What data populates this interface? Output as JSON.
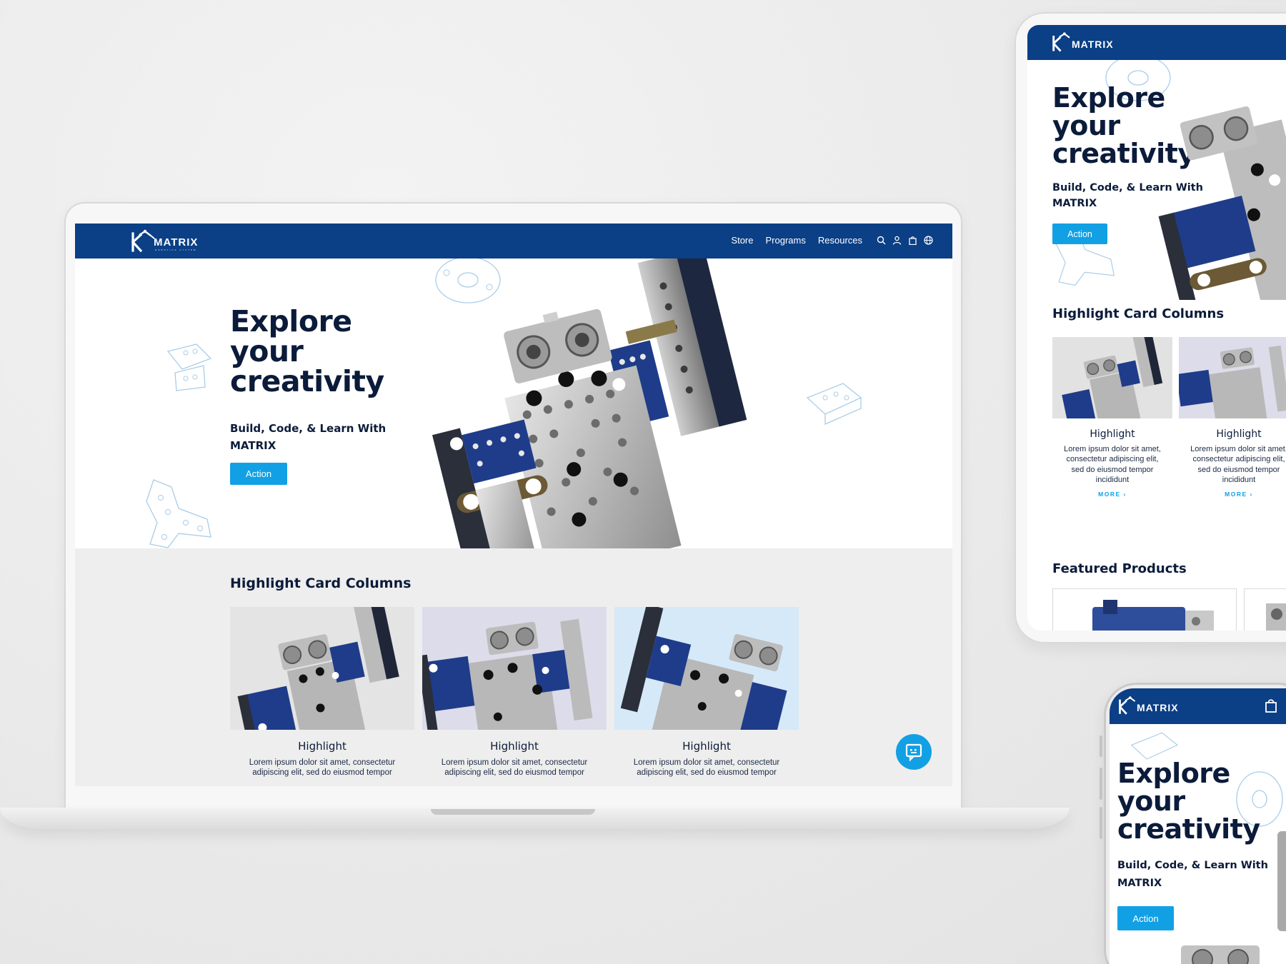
{
  "brand": {
    "name": "MATRIX",
    "tagline": "ROBOTICS SYSTEM"
  },
  "nav": {
    "links": [
      "Store",
      "Programs",
      "Resources"
    ]
  },
  "hero": {
    "title_lines": [
      "Explore",
      "your",
      "creativity"
    ],
    "subtitle_line1": "Build, Code, & Learn With",
    "subtitle_line2": "MATRIX",
    "action_label": "Action"
  },
  "highlights": {
    "title": "Highlight Card Columns",
    "cards": [
      {
        "title": "Highlight",
        "text": "Lorem ipsum dolor sit amet, consectetur adipiscing elit, sed do eiusmod tempor incididunt",
        "bg": "#e4e4e4"
      },
      {
        "title": "Highlight",
        "text": "Lorem ipsum dolor sit amet, consectetur adipiscing elit, sed do eiusmod tempor incididunt",
        "bg": "#dcdcea"
      },
      {
        "title": "Highlight",
        "text": "Lorem ipsum dolor sit amet, consectetur adipiscing elit, sed do eiusmod tempor incididunt",
        "bg": "#d6e9f8"
      }
    ],
    "more_label": "MORE"
  },
  "tablet": {
    "cards": [
      {
        "title": "Highlight",
        "text_lines": [
          "Lorem ipsum dolor sit amet,",
          "consectetur adipiscing elit,",
          "sed do eiusmod tempor",
          "incididunt"
        ]
      },
      {
        "title": "Highlight",
        "text_lines": [
          "Lorem ipsum dolor sit amet,",
          "consectetur adipiscing elit,",
          "sed do eiusmod tempor",
          "incididunt"
        ]
      }
    ],
    "featured_title": "Featured Products"
  },
  "colors": {
    "nav": "#0b3f86",
    "accent": "#12a0e4",
    "heading": "#0b1b3a"
  },
  "icons": [
    "search-icon",
    "user-icon",
    "bag-icon",
    "globe-icon",
    "chat-icon"
  ]
}
